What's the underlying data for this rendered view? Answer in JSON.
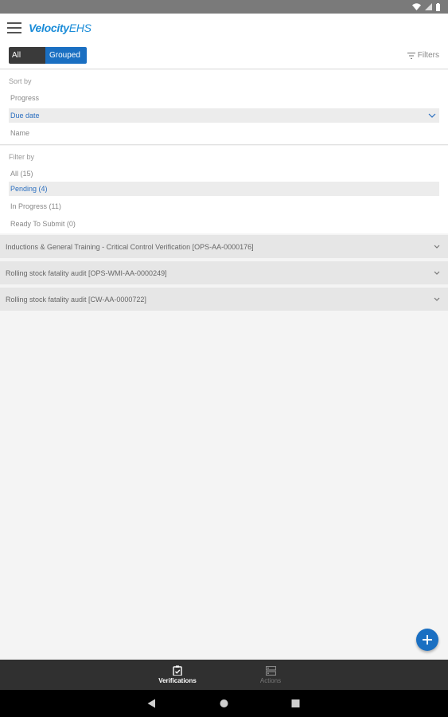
{
  "app": {
    "logo_main": "Velocity",
    "logo_suffix": "EHS"
  },
  "toolbar": {
    "toggle_all": "All",
    "toggle_grouped": "Grouped",
    "filters_label": "Filters"
  },
  "sort": {
    "label": "Sort by",
    "options": [
      "Progress",
      "Due date",
      "Name"
    ],
    "selected": "Due date"
  },
  "filter": {
    "label": "Filter by",
    "options": [
      "All (15)",
      "Pending (4)",
      "In Progress (11)",
      "Ready To Submit (0)"
    ],
    "selected": "Pending (4)"
  },
  "groups": [
    "Inductions & General Training - Critical Control Verification [OPS-AA-0000176]",
    "Rolling stock fatality audit [OPS-WMI-AA-0000249]",
    "Rolling stock fatality audit [CW-AA-0000722]"
  ],
  "bottom_nav": {
    "verifications": "Verifications",
    "actions": "Actions"
  },
  "colors": {
    "accent": "#1a6fc2",
    "brand": "#1a8cd8",
    "selected_text": "#2b6fc0"
  }
}
